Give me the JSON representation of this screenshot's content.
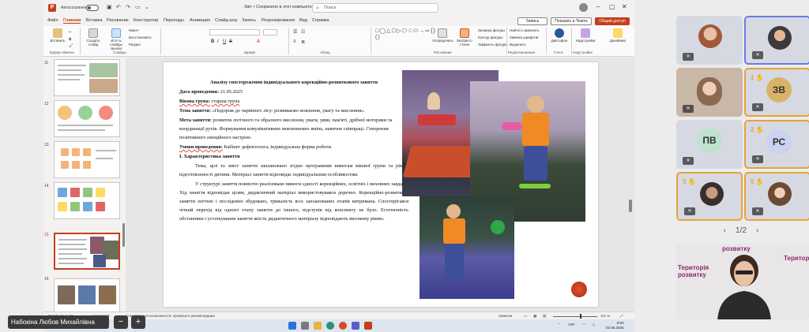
{
  "titlebar": {
    "autosave_label": "Автосохранение",
    "document_title": "Звіт • Сохранено в этот компьютер",
    "search_placeholder": "Поиск"
  },
  "menu": {
    "tabs": [
      "Файл",
      "Главная",
      "Вставка",
      "Рисование",
      "Конструктор",
      "Переходы",
      "Анимация",
      "Слайд-шоу",
      "Запись",
      "Рецензирование",
      "Вид",
      "Справка"
    ],
    "active": "Главная",
    "record_label": "Запись",
    "teams_label": "Показать в Teams",
    "share_label": "Общий доступ"
  },
  "ribbon": {
    "groups": [
      "Буфер обмена",
      "Слайды",
      "Шрифт",
      "Абзац",
      "Рисование",
      "Редактирование",
      "Голос",
      "Надстройки"
    ],
    "paste": "Вставить",
    "new_slide": "Создать слайд",
    "reuse_slides": "Исп-ть слайды заново",
    "layout": "Макет",
    "reset": "Восстановить",
    "section": "Раздел",
    "arrange": "Упорядочить",
    "quick_styles": "Экспресс-стили",
    "fill": "Заливка фигуры",
    "outline": "Контур фигуры",
    "effects": "Эффекты фигуры",
    "find": "Найти и заменить",
    "replace_fonts": "Замена шрифтов",
    "select": "Выделить",
    "dictate": "Диктофон",
    "addins": "Надстройки",
    "designer": "Дизайнер",
    "shape_glyphs": "□◯△⬠▷⬡☆⬭→⇨{}()"
  },
  "thumbnails": [
    {
      "num": "11"
    },
    {
      "num": "12"
    },
    {
      "num": "13"
    },
    {
      "num": "14"
    },
    {
      "num": "15"
    },
    {
      "num": "16"
    }
  ],
  "slide": {
    "title": "Аналізу спостереження індивідуального корекційно-розвиткового заняття",
    "date_label": "Дата проведення:",
    "date_value": "21.05.2025",
    "age_label": "Вікова група:",
    "age_value": "старша група",
    "topic_label": "Тема заняття:",
    "topic_value": "«Подорож до чарівного лісу: розвиваємо мовлення, увагу та мислення».",
    "goal_label": "Мета заняття:",
    "goal_value": "розвиток логічного та образного мислення, уваги, уяви, пам'яті, дрібної моторики та координації рухів. Формування комунікативних мовленнєвих вмінь, навичок співпраці. Створення позитивного емоційного настрою.",
    "conditions_label": "Умови проведення:",
    "conditions_value": "Кабінет дефектолога, індивідуальна форма роботи.",
    "section_heading": "І. Характеристика заняття",
    "para1": "Тема, цілі та зміст заняття заплановано згідно програмним вимогам вікової групи та рівню підготовленості дитини. Матеріал заняття відповідає індивідуальним особливостям.",
    "para2": "У структурі заняття повністю реалізовано вимоги єдності корекційних, освітніх і виховних завдань. Хід заняття відповідав цілям, дидактичний матеріал використовувався доречно. Корекційно-розвиткове заняття логічно і послідовно збудовано, тривалість всіх запланованих етапів витримана. Спостерігався чіткий перехід від одного етапу заняття до іншого, відступів від конспекту не було. Естетичність обстановки і устаткування заняття якість дидактичного матеріалу відповідають високому рівню."
  },
  "statusbar": {
    "slide_info": "Слайд 15 из 20",
    "language": "украинский",
    "accessibility": "Специальные возможности: проверьте рекомендации",
    "notes": "Заметки",
    "zoom": "111 %",
    "zoom_fraction": 0.6
  },
  "taskbar": {
    "lang": "УКР",
    "time": "9:53",
    "date": "02.06.2025"
  },
  "presenter": {
    "name": "Набокіна Любов Михайлівна",
    "minus": "−",
    "plus": "+"
  },
  "participants": [
    {
      "initials": "",
      "raised_hand": "",
      "muted": true,
      "photo_color": "#c98a6c"
    },
    {
      "initials": "",
      "raised_hand": "",
      "muted": true,
      "photo_color": "#3c3a3c",
      "presenting": true
    },
    {
      "initials": "",
      "raised_hand": "",
      "muted": true,
      "photo_color": "#d2b7a5"
    },
    {
      "initials": "ЗВ",
      "raised_hand": "1",
      "muted": true,
      "avatar_color": "#d9b26a"
    },
    {
      "initials": "ПВ",
      "raised_hand": "",
      "muted": true,
      "avatar_color": "#bfe2cf"
    },
    {
      "initials": "РС",
      "raised_hand": "2",
      "muted": true,
      "avatar_color": "#cbd3f1"
    },
    {
      "initials": "",
      "raised_hand": "3",
      "muted": true,
      "photo_color": "#6a5a55"
    },
    {
      "initials": "",
      "raised_hand": "5",
      "muted": true,
      "photo_color": "#c8a888"
    }
  ],
  "pager": {
    "label": "1/2",
    "prev": "‹",
    "next": "›"
  },
  "camera": {
    "sign_left": "Територія розвитку",
    "sign_top": "розвитку",
    "sign_right": "Територія"
  },
  "colors": {
    "accent": "#c43e1c",
    "raised_hand": "#e8a33a",
    "presenter_frame": "#6b7ae0"
  }
}
